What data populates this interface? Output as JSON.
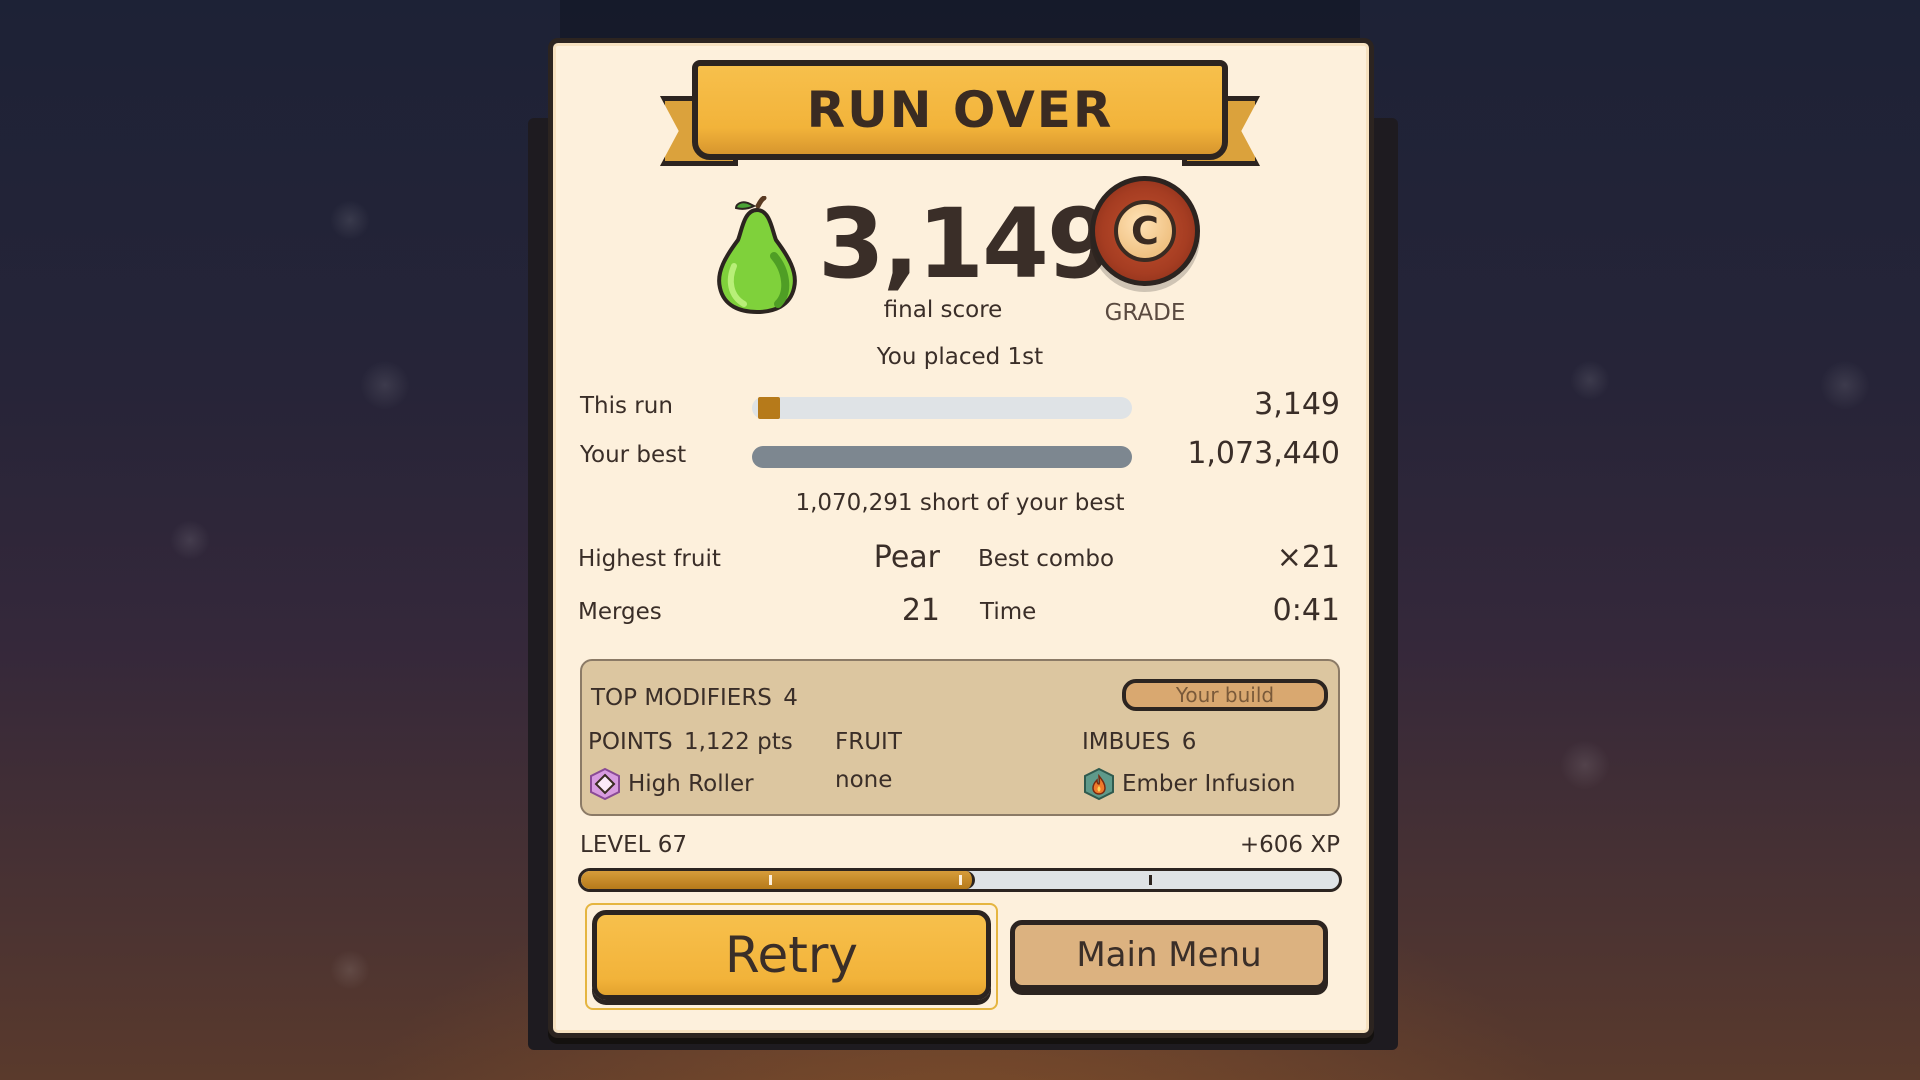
{
  "banner": {
    "title": "RUN OVER"
  },
  "score": {
    "value": "3,149",
    "label": "final score"
  },
  "grade": {
    "letter": "C",
    "label": "GRADE"
  },
  "placement": "You placed 1st",
  "comparison": {
    "this_run": {
      "label": "This run",
      "value": "3,149",
      "fraction": 0.0029
    },
    "your_best": {
      "label": "Your best",
      "value": "1,073,440",
      "fraction": 1.0
    },
    "short_text": "1,070,291 short of your best"
  },
  "stats": {
    "highest_fruit": {
      "label": "Highest fruit",
      "value": "Pear"
    },
    "best_combo": {
      "label": "Best combo",
      "value": "×21"
    },
    "merges": {
      "label": "Merges",
      "value": "21"
    },
    "time": {
      "label": "Time",
      "value": "0:41"
    }
  },
  "modifiers": {
    "title": "TOP MODIFIERS",
    "count": "4",
    "build_button": "Your build",
    "points": {
      "title": "POINTS",
      "amount": "1,122 pts",
      "item": "High Roller",
      "icon": "diamond-icon"
    },
    "fruit": {
      "title": "FRUIT",
      "item": "none"
    },
    "imbues": {
      "title": "IMBUES",
      "count": "6",
      "item": "Ember Infusion",
      "icon": "flame-potion-icon"
    }
  },
  "level": {
    "label": "LEVEL 67",
    "xp_gain": "+606 XP",
    "progress": 0.52
  },
  "buttons": {
    "retry": "Retry",
    "main_menu": "Main Menu"
  },
  "colors": {
    "accent_gold": "#f2b33a",
    "panel": "#fdf0dc",
    "grade_red": "#a63d22",
    "progress_brown": "#b67a1a"
  }
}
